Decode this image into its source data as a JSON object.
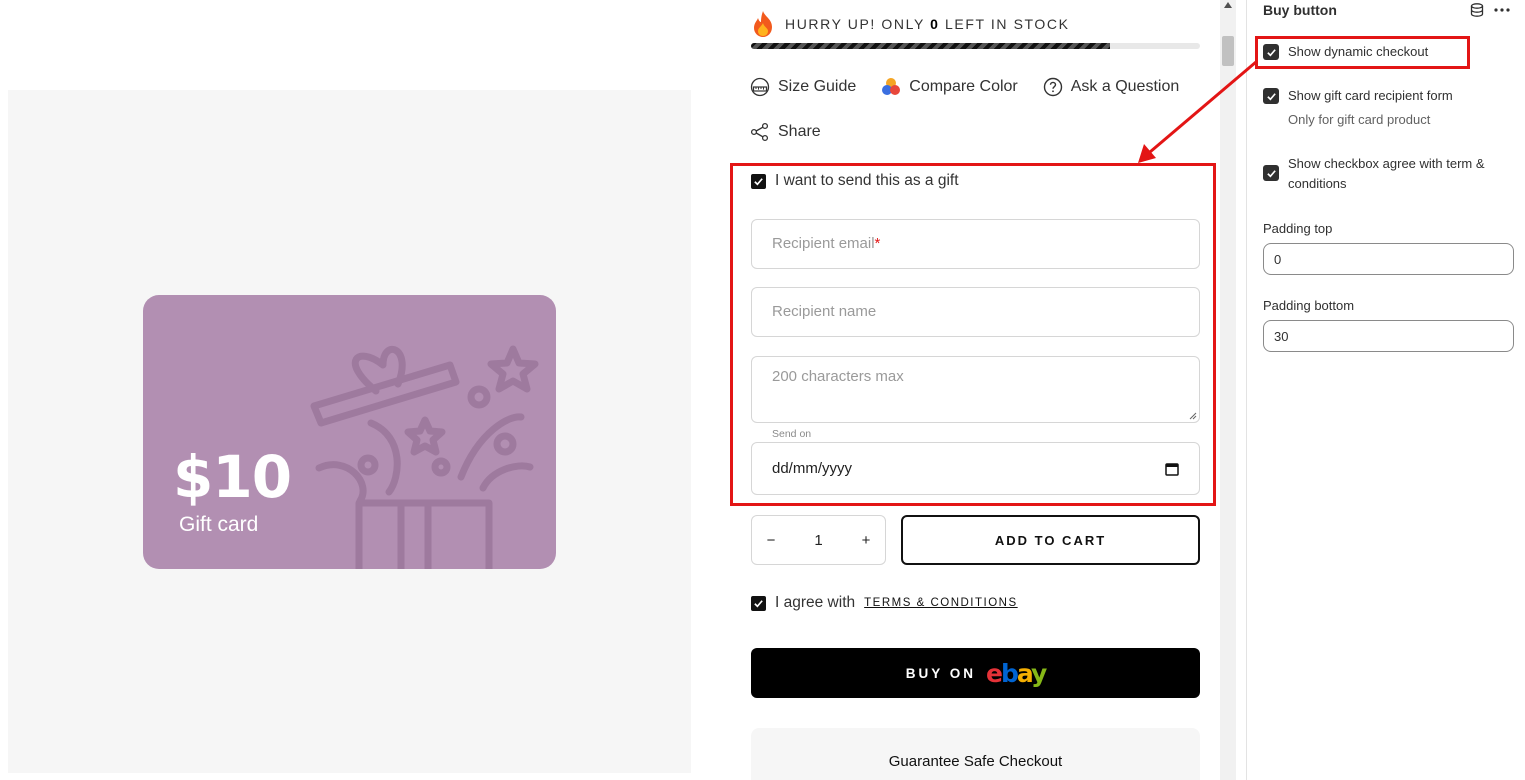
{
  "gift_card": {
    "amount": "$10",
    "label": "Gift card"
  },
  "stock": {
    "prefix": "HURRY UP! ONLY",
    "count": "0",
    "suffix": "LEFT IN STOCK",
    "progress_percent": 80
  },
  "links": [
    {
      "label": "Size Guide",
      "icon": "ruler-icon"
    },
    {
      "label": "Compare Color",
      "icon": "color-circles-icon"
    },
    {
      "label": "Ask a Question",
      "icon": "question-circle-icon"
    },
    {
      "label": "Share",
      "icon": "share-icon"
    }
  ],
  "gift_form": {
    "checkbox_label": "I want to send this as a gift",
    "checked": true,
    "recipient_email_placeholder": "Recipient email",
    "required_mark": "*",
    "recipient_name_placeholder": "Recipient name",
    "message_placeholder": "200 characters max",
    "send_on_label": "Send on",
    "date_placeholder": "dd/mm/yyyy"
  },
  "quantity": {
    "value": "1",
    "minus": "−",
    "plus": "+"
  },
  "add_to_cart_label": "ADD TO CART",
  "agree": {
    "prefix": "I agree with",
    "link": "TERMS & CONDITIONS"
  },
  "buy_button": {
    "label": "BUY ON",
    "brand": "ebay"
  },
  "guarantee_title": "Guarantee Safe Checkout",
  "settings": {
    "title": "Buy button",
    "options": [
      {
        "label": "Show dynamic checkout",
        "checked": true,
        "sub": ""
      },
      {
        "label": "Show gift card recipient form",
        "checked": true,
        "sub": "Only for gift card product"
      },
      {
        "label": "Show checkbox agree with term & conditions",
        "checked": true,
        "sub": ""
      }
    ],
    "padding_top_label": "Padding top",
    "padding_top_value": "0",
    "padding_bottom_label": "Padding bottom",
    "padding_bottom_value": "30"
  },
  "colors": {
    "card": "#b28fb2",
    "highlight": "#e31515",
    "button": "#000000"
  }
}
